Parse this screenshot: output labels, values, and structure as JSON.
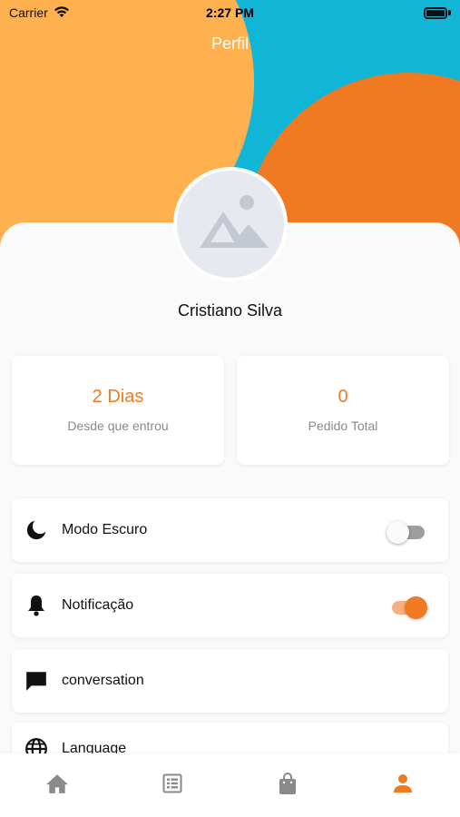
{
  "status_bar": {
    "carrier": "Carrier",
    "time": "2:27 PM"
  },
  "header": {
    "title": "Perfil"
  },
  "profile": {
    "name": "Cristiano Silva",
    "avatar_icon": "image-placeholder-icon"
  },
  "stats": [
    {
      "value": "2 Dias",
      "label": "Desde que entrou"
    },
    {
      "value": "0",
      "label": "Pedido Total"
    }
  ],
  "settings": [
    {
      "label": "Modo Escuro",
      "icon": "moon-icon",
      "toggle": false
    },
    {
      "label": "Notificação",
      "icon": "bell-icon",
      "toggle": true
    },
    {
      "label": "conversation",
      "icon": "chat-icon"
    },
    {
      "label": "Language",
      "icon": "globe-icon"
    }
  ],
  "tab_bar": {
    "items": [
      {
        "icon": "home-icon",
        "active": false
      },
      {
        "icon": "list-icon",
        "active": false
      },
      {
        "icon": "bag-icon",
        "active": false
      },
      {
        "icon": "person-icon",
        "active": true
      }
    ]
  },
  "colors": {
    "accent": "#ef7a22",
    "teal": "#11b6d6",
    "yellow": "#ffb14f",
    "inactive": "#8a8a8a"
  }
}
